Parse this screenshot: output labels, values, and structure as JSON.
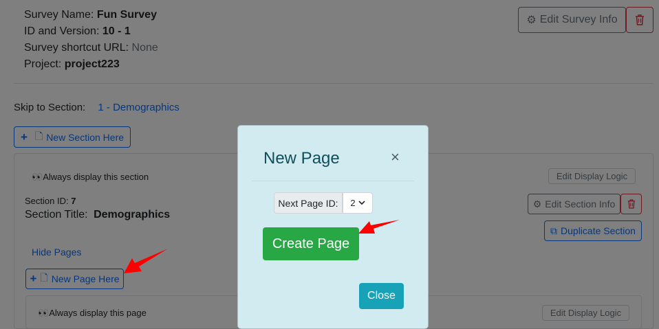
{
  "survey": {
    "name_label": "Survey Name:",
    "name": "Fun Survey",
    "id_label": "ID and Version:",
    "id_version": "10 - 1",
    "shortcut_label": "Survey shortcut URL:",
    "shortcut_value": "None",
    "project_label": "Project:",
    "project": "project223",
    "edit_info_label": "Edit Survey Info"
  },
  "skip": {
    "label": "Skip to Section:",
    "link": "1 - Demographics"
  },
  "new_section_label": "New Section Here",
  "section": {
    "display_text": "Always display this section",
    "edit_logic_label": "Edit Display Logic",
    "id_label": "Section ID:",
    "id": "7",
    "title_label": "Section Title:",
    "title": "Demographics",
    "edit_info_label": "Edit Section Info",
    "duplicate_label": "Duplicate Section",
    "hide_pages_label": "Hide Pages",
    "new_page_label": "New Page Here"
  },
  "page": {
    "display_text": "Always display this page",
    "edit_logic_label": "Edit Display Logic"
  },
  "modal": {
    "title": "New Page",
    "close_symbol": "×",
    "next_page_id_label": "Next Page ID:",
    "next_page_id_value": "2",
    "create_label": "Create Page",
    "close_label": "Close"
  },
  "colors": {
    "annotation_arrow": "#ff0000",
    "create_button": "#28a745",
    "close_button": "#17a2b8",
    "modal_bg": "#d2ebf0"
  }
}
